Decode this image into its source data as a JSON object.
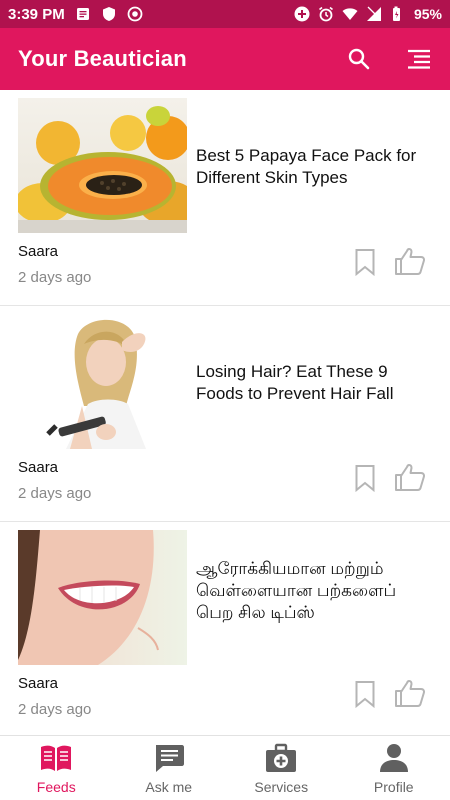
{
  "status_bar": {
    "time": "3:39 PM",
    "battery": "95%",
    "left_icons": [
      "notes-icon",
      "shield-icon",
      "record-icon"
    ],
    "right_icons": [
      "add-circle-icon",
      "alarm-icon",
      "wifi-icon",
      "signal-icon",
      "battery-icon"
    ]
  },
  "app_bar": {
    "title": "Your Beautician",
    "background": "#e0175e",
    "actions": [
      "search-icon",
      "menu-icon"
    ]
  },
  "feed": {
    "items": [
      {
        "title": "Best 5 Papaya Face Pack for Different Skin Types",
        "author": "Saara",
        "time": "2 days ago",
        "image": "papaya-image"
      },
      {
        "title": "Losing Hair? Eat These 9 Foods to Prevent Hair Fall",
        "author": "Saara",
        "time": "2 days ago",
        "image": "hair-loss-image"
      },
      {
        "title": "ஆரோக்கியமான மற்றும் வெள்ளையான பற்களைப் பெற சில டிப்ஸ்",
        "author": "Saara",
        "time": "2 days ago",
        "image": "smile-teeth-image"
      }
    ]
  },
  "bottom_nav": {
    "active_color": "#e0175e",
    "items": [
      {
        "label": "Feeds",
        "icon": "book-icon",
        "active": true
      },
      {
        "label": "Ask me",
        "icon": "chat-icon",
        "active": false
      },
      {
        "label": "Services",
        "icon": "medical-kit-icon",
        "active": false
      },
      {
        "label": "Profile",
        "icon": "person-icon",
        "active": false
      }
    ]
  }
}
